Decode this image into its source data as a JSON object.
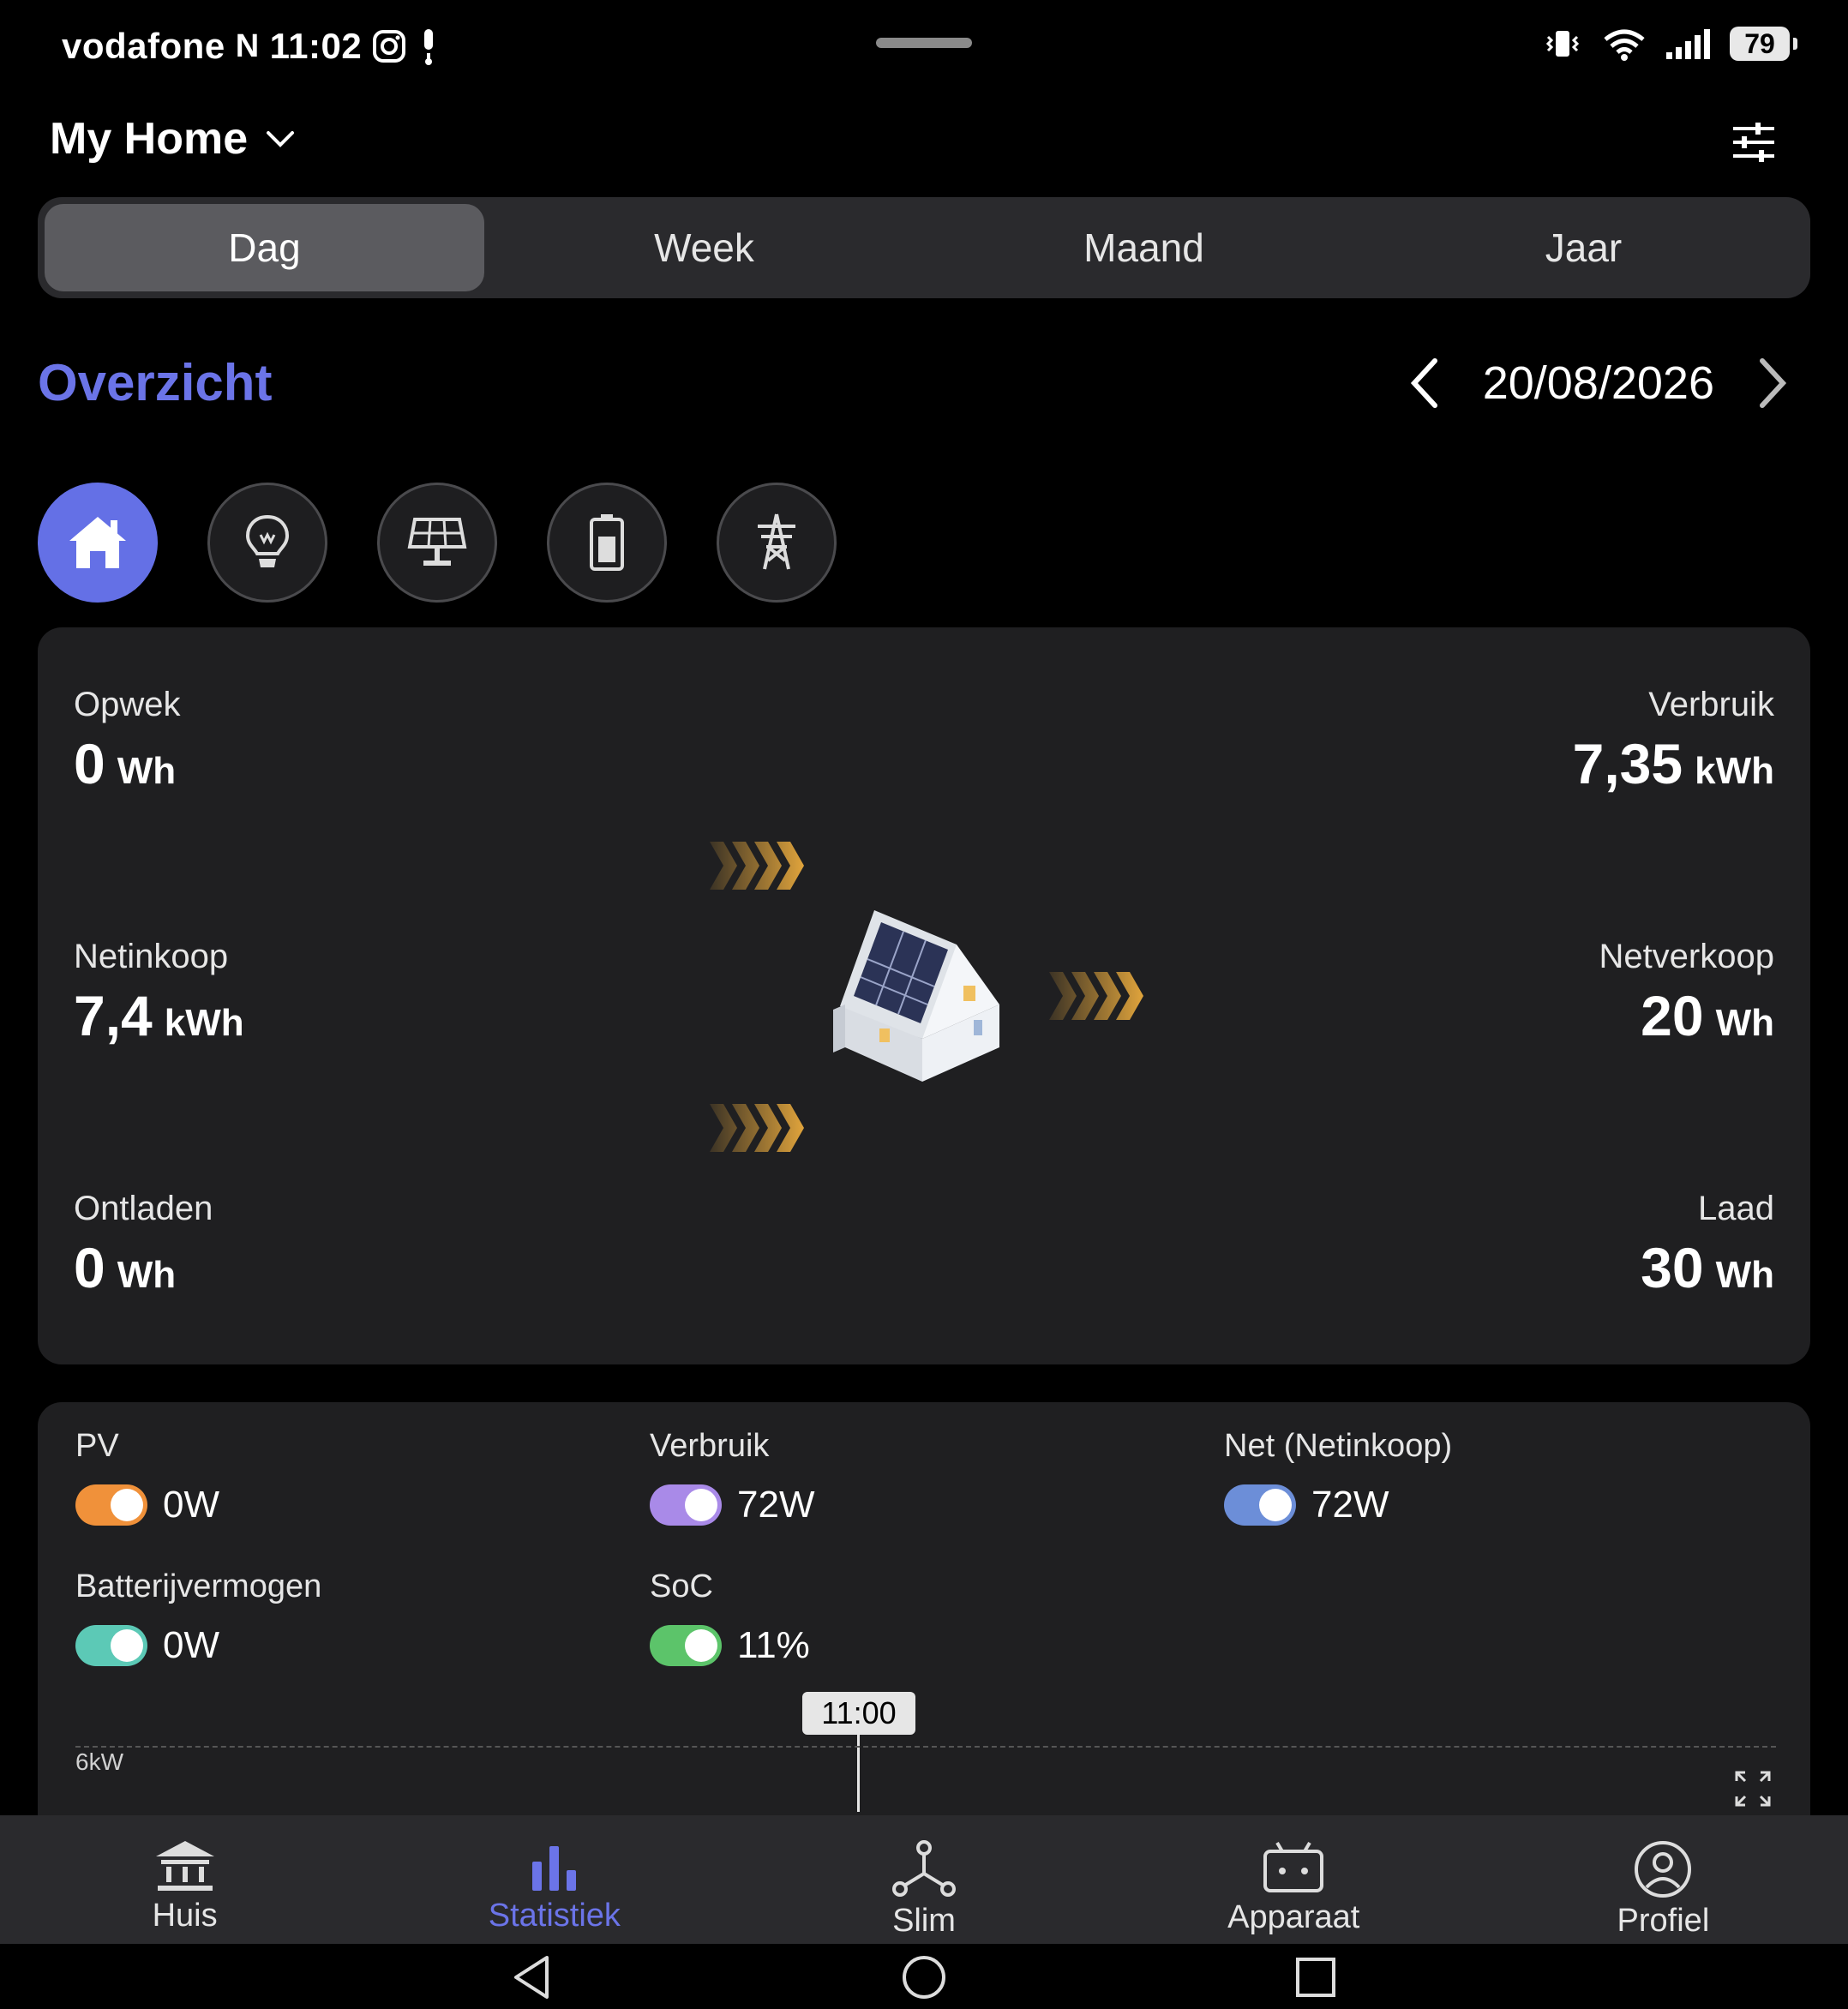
{
  "status_bar": {
    "carrier": "vodafone",
    "carrier_badge": "N",
    "time": "11:02",
    "battery": "79"
  },
  "header": {
    "title": "My Home"
  },
  "tabs": [
    {
      "label": "Dag",
      "active": true
    },
    {
      "label": "Week",
      "active": false
    },
    {
      "label": "Maand",
      "active": false
    },
    {
      "label": "Jaar",
      "active": false
    }
  ],
  "overview": {
    "title": "Overzicht",
    "date": "20/08/2026"
  },
  "categories": [
    "home-icon",
    "bulb-icon",
    "solar-panel-icon",
    "battery-icon",
    "pylon-icon"
  ],
  "flow": {
    "opwek": {
      "label": "Opwek",
      "value": "0",
      "unit": "Wh"
    },
    "verbruik": {
      "label": "Verbruik",
      "value": "7,35",
      "unit": "kWh"
    },
    "netinkoop": {
      "label": "Netinkoop",
      "value": "7,4",
      "unit": "kWh"
    },
    "netverkoop": {
      "label": "Netverkoop",
      "value": "20",
      "unit": "Wh"
    },
    "ontladen": {
      "label": "Ontladen",
      "value": "0",
      "unit": "Wh"
    },
    "laad": {
      "label": "Laad",
      "value": "30",
      "unit": "Wh"
    }
  },
  "power": {
    "pv": {
      "label": "PV",
      "value": "0W",
      "color": "#f0913a"
    },
    "verbruik": {
      "label": "Verbruik",
      "value": "72W",
      "color": "#a98ae8"
    },
    "net": {
      "label": "Net (Netinkoop)",
      "value": "72W",
      "color": "#6c8ed8"
    },
    "batterij": {
      "label": "Batterijvermogen",
      "value": "0W",
      "color": "#5cc9b6"
    },
    "soc": {
      "label": "SoC",
      "value": "11%",
      "color": "#5cc46a"
    }
  },
  "chart": {
    "cursor_time": "11:00",
    "y_max_label": "6kW"
  },
  "bottom_nav": [
    {
      "label": "Huis",
      "icon": "bank-icon",
      "active": false
    },
    {
      "label": "Statistiek",
      "icon": "bar-chart-icon",
      "active": true
    },
    {
      "label": "Slim",
      "icon": "network-icon",
      "active": false
    },
    {
      "label": "Apparaat",
      "icon": "device-icon",
      "active": false
    },
    {
      "label": "Profiel",
      "icon": "profile-icon",
      "active": false
    }
  ],
  "colors": {
    "accent": "#6b74e8",
    "card": "#1f1f21",
    "arrow": "#e0a43c"
  }
}
